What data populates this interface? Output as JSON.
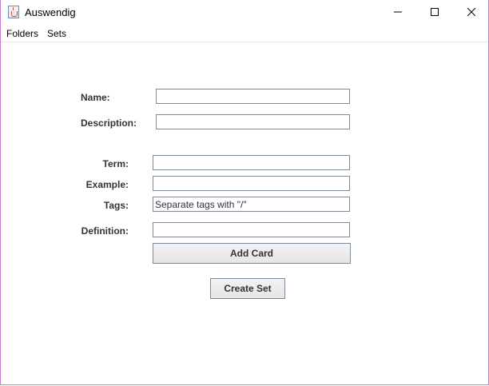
{
  "window": {
    "title": "Auswendig"
  },
  "menu": {
    "folders": "Folders",
    "sets": "Sets"
  },
  "form": {
    "name_label": "Name:",
    "description_label": "Description:",
    "term_label": "Term:",
    "example_label": "Example:",
    "tags_label": "Tags:",
    "tags_value": "Separate tags with \"/\"",
    "definition_label": "Definition:",
    "add_card_label": "Add Card",
    "create_set_label": "Create Set"
  },
  "icons": {
    "app": "java-app-icon",
    "minimize": "minimize-icon",
    "maximize": "maximize-icon",
    "close": "close-icon"
  }
}
